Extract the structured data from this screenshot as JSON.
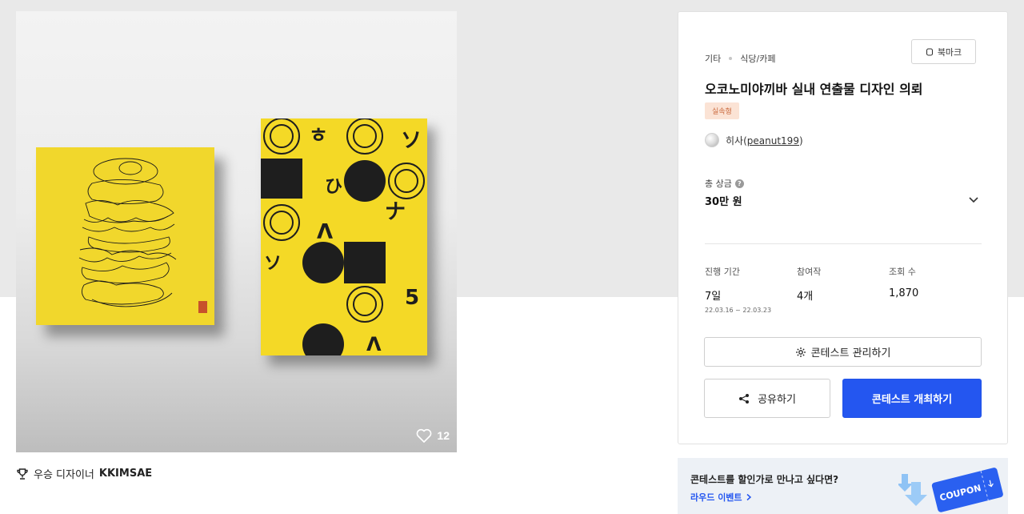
{
  "hero": {
    "like_count": "12"
  },
  "designer": {
    "prefix": "우승 디자이너",
    "name": "KKIMSAE"
  },
  "panel": {
    "breadcrumb": [
      "기타",
      "식당/카페"
    ],
    "bookmark_label": "북마크",
    "title": "오코노미야끼바 실내 연출물 디자인 의뢰",
    "badge": "실속형",
    "host": {
      "name": "히사",
      "userid": "peanut199"
    },
    "prize": {
      "label": "총 상금",
      "value": "30만 원"
    },
    "stats": [
      {
        "label": "진행 기간",
        "value": "7일",
        "sub": "22.03.16 ~ 22.03.23"
      },
      {
        "label": "참여작",
        "value": "4개",
        "sub": ""
      },
      {
        "label": "조회 수",
        "value": "1,870",
        "sub": ""
      }
    ],
    "buttons": {
      "manage": "콘테스트 관리하기",
      "share": "공유하기",
      "open": "콘테스트 개최하기"
    }
  },
  "coupon": {
    "text": "콘테스트를 할인가로 만나고 싶다면?",
    "link": "라우드 이벤트",
    "art_text": "COUPON"
  },
  "colors": {
    "primary": "#2456f0",
    "badge_bg": "#fbe3d5",
    "badge_text": "#c9683c",
    "poster_yellow": "#f4d926"
  }
}
